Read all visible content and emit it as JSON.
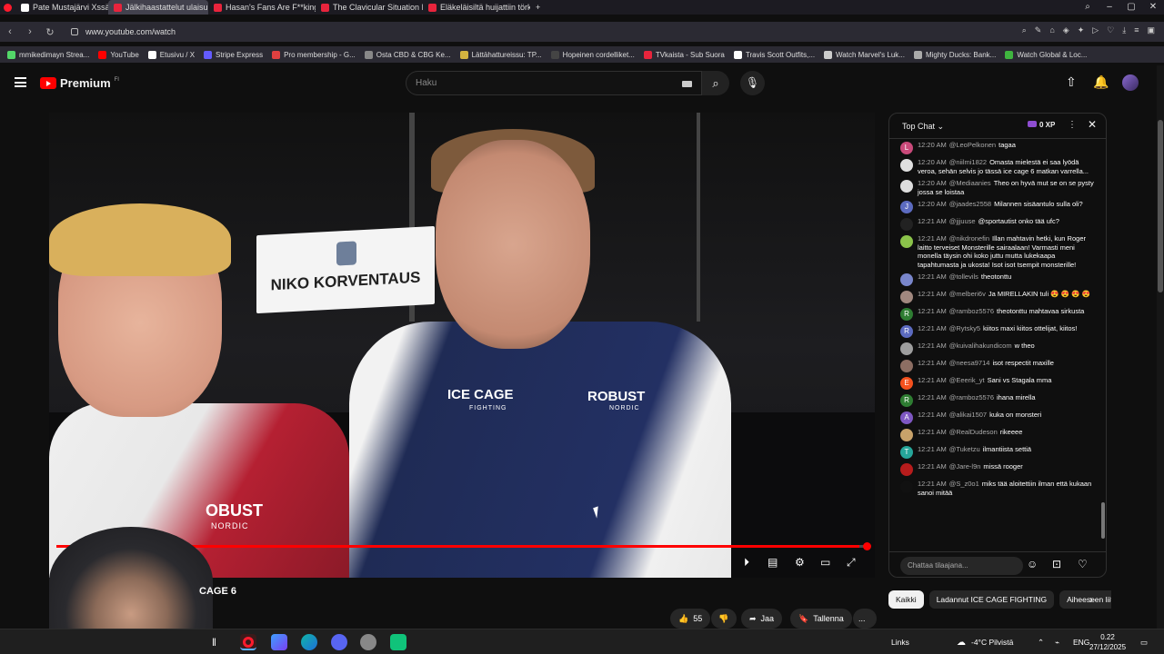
{
  "browser": {
    "tabs": [
      {
        "label": "Pate Mustajärvi Xssä: \"En...",
        "active": false
      },
      {
        "label": "Jälkihaastattelut ulaisu...",
        "active": true
      },
      {
        "label": "Hasan's Fans Are F**king ...",
        "active": false
      },
      {
        "label": "The Clavicular Situation Is...",
        "active": false
      },
      {
        "label": "Eläkeläisiltä huijattiin törke...",
        "active": false
      }
    ],
    "new_tab": "+",
    "url": "www.youtube.com/watch",
    "bookmarks": [
      {
        "label": "mmikedimayn Strea...",
        "color": "#53d769"
      },
      {
        "label": "YouTube",
        "color": "#ff0000"
      },
      {
        "label": "Etusivu / X",
        "color": "#ffffff"
      },
      {
        "label": "Stripe Express",
        "color": "#635bff"
      },
      {
        "label": "Pro membership - G...",
        "color": "#e04040"
      },
      {
        "label": "Osta CBD & CBG Ke...",
        "color": "#888888"
      },
      {
        "label": "Lättähattureissu: TP...",
        "color": "#d4b440"
      },
      {
        "label": "Hopeinen cordelliket...",
        "color": "#444444"
      },
      {
        "label": "TVkaista - Sub Suora",
        "color": "#e8243c"
      },
      {
        "label": "Travis Scott Outfits,...",
        "color": "#ffffff"
      },
      {
        "label": "Watch Marvel's Luk...",
        "color": "#cccccc"
      },
      {
        "label": "Mighty Ducks: Bank...",
        "color": "#aaaaaa"
      },
      {
        "label": "Watch Global & Loc...",
        "color": "#3fb43f"
      }
    ]
  },
  "youtube": {
    "logo": "Premium",
    "region": "FI",
    "search_placeholder": "Haku"
  },
  "video": {
    "name_card": "NIKO KORVENTAUS",
    "shirt_text_1": "ICE CAGE",
    "shirt_sub_1": "FIGHTING",
    "shirt_text_2": "ROBUST",
    "shirt_sub_2": "NORDIC",
    "shirt_text_3": "OBUST",
    "shirt_sub_3": "NORDIC",
    "progress": 0.99,
    "title_fragment": "CAGE 6"
  },
  "actions": {
    "likes": "55",
    "share": "Jaa",
    "save": "Tallenna",
    "more": "..."
  },
  "chat": {
    "mode": "Top Chat",
    "xp": "0 XP",
    "input_placeholder": "Chattaa tilaajana...",
    "messages": [
      {
        "time": "12:20 AM",
        "user": "@LeoPelkonen",
        "text": "tagaa",
        "color": "#c94a7a",
        "initial": "L"
      },
      {
        "time": "12:20 AM",
        "user": "@niilmi1822",
        "text": "Omasta mielestä ei saa lyödä veroa, sehän selvis jo tässä ice cage 6 matkan varrella...",
        "color": "#e0e0e0",
        "initial": ""
      },
      {
        "time": "12:20 AM",
        "user": "@Mediaanies",
        "text": "Theo on hyvä mut se on se pysty jossa se loistaa",
        "color": "#dddddd",
        "initial": ""
      },
      {
        "time": "12:20 AM",
        "user": "@jaades2558",
        "text": "Milannen sisäantulo sulla oli?",
        "color": "#5c6bc0",
        "initial": "J"
      },
      {
        "time": "12:21 AM",
        "user": "@jjjuuse",
        "text": "@sportautist onko tää ufc?",
        "color": "#222222",
        "initial": ""
      },
      {
        "time": "12:21 AM",
        "user": "@nikdronefin",
        "text": "Illan mahtavin hetki, kun Roger laitto terveiset Monsterille sairaalaan! Varmasti meni monella täysin ohi koko juttu mutta lukekaapa tapahtumasta ja ukosta! Isot isot tsempit monsterille!",
        "color": "#8bc34a",
        "initial": ""
      },
      {
        "time": "12:21 AM",
        "user": "@tollevils",
        "text": "theotonttu",
        "color": "#7986cb",
        "initial": ""
      },
      {
        "time": "12:21 AM",
        "user": "@melberi6v",
        "text": "Ja MIRELLAKIN tuli 😍 😍 😍 😍",
        "color": "#a1887f",
        "initial": ""
      },
      {
        "time": "12:21 AM",
        "user": "@ramboz5576",
        "text": "theotonttu mahtavaa sirkusta",
        "color": "#2e7d32",
        "initial": "R"
      },
      {
        "time": "12:21 AM",
        "user": "@Rytsky5",
        "text": "kiitos maxi kiitos ottelijat, kiitos!",
        "color": "#5c6bc0",
        "initial": "R"
      },
      {
        "time": "12:21 AM",
        "user": "@kuivalihakundicom",
        "text": "w theo",
        "color": "#9e9e9e",
        "initial": ""
      },
      {
        "time": "12:21 AM",
        "user": "@neesa9714",
        "text": "isot respectit maxille",
        "color": "#8d6e63",
        "initial": ""
      },
      {
        "time": "12:21 AM",
        "user": "@Eeerik_yt",
        "text": "Sani vs Stagala mma",
        "color": "#f4511e",
        "initial": "E"
      },
      {
        "time": "12:21 AM",
        "user": "@ramboz5576",
        "text": "ihana mirella",
        "color": "#2e7d32",
        "initial": "R"
      },
      {
        "time": "12:21 AM",
        "user": "@alikai1507",
        "text": "kuka on monsteri",
        "color": "#7e57c2",
        "initial": "A"
      },
      {
        "time": "12:21 AM",
        "user": "@RealDudeson",
        "text": "rikeeee",
        "color": "#c8a26a",
        "initial": ""
      },
      {
        "time": "12:21 AM",
        "user": "@Tuketzu",
        "text": "ilmantiista settiä",
        "color": "#26a69a",
        "initial": "T"
      },
      {
        "time": "12:21 AM",
        "user": "@Jare-l9n",
        "text": "missä rooger",
        "color": "#b71c1c",
        "initial": ""
      },
      {
        "time": "12:21 AM",
        "user": "@S_z0o1",
        "text": "miks tää aloitettiin ilman että kukaan sanoi mitää",
        "color": "#111111",
        "initial": ""
      }
    ],
    "chips": [
      {
        "label": "Kaikki",
        "active": true
      },
      {
        "label": "Ladannut ICE CAGE FIGHTING",
        "active": false
      },
      {
        "label": "Aiheeseen liittyvät",
        "active": false
      }
    ]
  },
  "taskbar": {
    "links_label": "Links",
    "weather": "-4°C Pilvistä",
    "lang": "ENG",
    "time": "0.22",
    "date": "27/12/2025"
  }
}
